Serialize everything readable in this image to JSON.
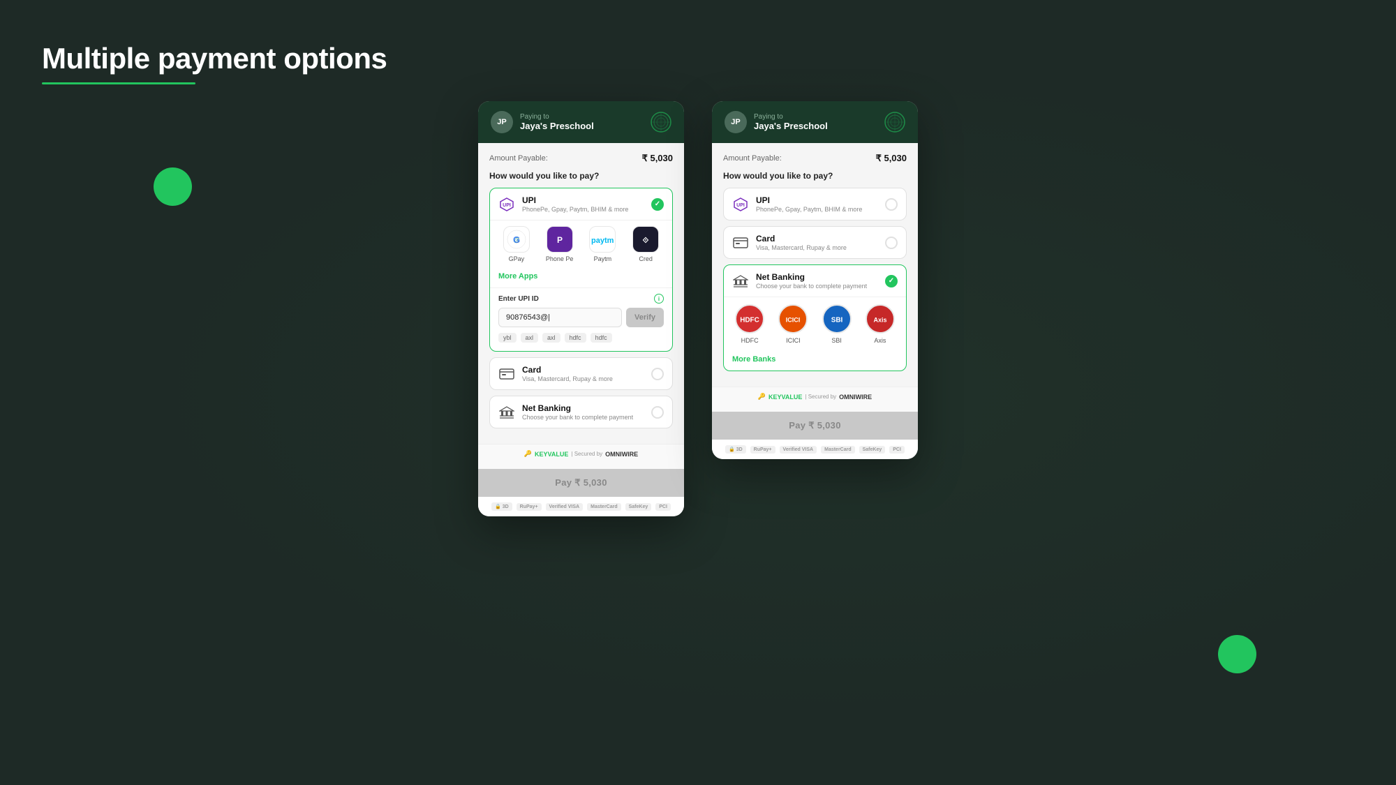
{
  "page": {
    "title": "Multiple payment options",
    "background_color": "#1e2a26"
  },
  "card_left": {
    "header": {
      "paying_to_label": "Paying to",
      "merchant_name": "Jaya's Preschool",
      "avatar_initials": "JP"
    },
    "amount_label": "Amount Payable:",
    "amount_value": "₹ 5,030",
    "pay_question": "How would you like to pay?",
    "upi_section": {
      "title": "UPI",
      "subtitle": "PhonePe, Gpay, Paytm, BHIM & more",
      "active": true,
      "apps": [
        {
          "name": "GPay",
          "icon": "G"
        },
        {
          "name": "Phone Pe",
          "icon": "P"
        },
        {
          "name": "Paytm",
          "icon": "T"
        },
        {
          "name": "Cred",
          "icon": "C"
        }
      ],
      "more_apps_label": "More Apps",
      "upi_id_label": "Enter UPI ID",
      "upi_id_value": "90876543@|",
      "verify_label": "Verify",
      "suggestions": [
        "ybl",
        "axl",
        "axl",
        "hdfc",
        "hdfc"
      ]
    },
    "card_section": {
      "title": "Card",
      "subtitle": "Visa, Mastercard, Rupay & more",
      "active": false
    },
    "netbanking_section": {
      "title": "Net Banking",
      "subtitle": "Choose your bank to complete payment",
      "active": false
    },
    "footer": {
      "keyvalue_text": "KEYVALUE",
      "secured_text": "| Secured by",
      "omniwire_text": "OMNIWIRE"
    },
    "pay_button_label": "Pay ₹ 5,030",
    "trust_badges": [
      "3D Secure",
      "RuPay+",
      "Verified by VISA",
      "MasterCard",
      "SafeKey",
      "PCI"
    ]
  },
  "card_right": {
    "header": {
      "paying_to_label": "Paying to",
      "merchant_name": "Jaya's Preschool",
      "avatar_initials": "JP"
    },
    "amount_label": "Amount Payable:",
    "amount_value": "₹ 5,030",
    "pay_question": "How would you like to pay?",
    "upi_section": {
      "title": "UPI",
      "subtitle": "PhonePe, Gpay, Paytm, BHIM & more",
      "active": false
    },
    "card_section": {
      "title": "Card",
      "subtitle": "Visa, Mastercard, Rupay & more",
      "active": false
    },
    "netbanking_section": {
      "title": "Net Banking",
      "subtitle": "Choose your bank to complete payment",
      "active": true,
      "banks": [
        {
          "name": "HDFC",
          "color": "#d32f2f",
          "abbr": "H"
        },
        {
          "name": "ICICI",
          "color": "#e65100",
          "abbr": "I"
        },
        {
          "name": "SBI",
          "color": "#1565c0",
          "abbr": "S"
        },
        {
          "name": "Axis",
          "color": "#c62828",
          "abbr": "A"
        }
      ],
      "more_banks_label": "More Banks"
    },
    "footer": {
      "keyvalue_text": "KEYVALUE",
      "secured_text": "| Secured by",
      "omniwire_text": "OMNIWIRE"
    },
    "pay_button_label": "Pay ₹ 5,030",
    "trust_badges": [
      "3D Secure",
      "RuPay+",
      "Verified by VISA",
      "MasterCard",
      "SafeKey",
      "PCI"
    ]
  }
}
